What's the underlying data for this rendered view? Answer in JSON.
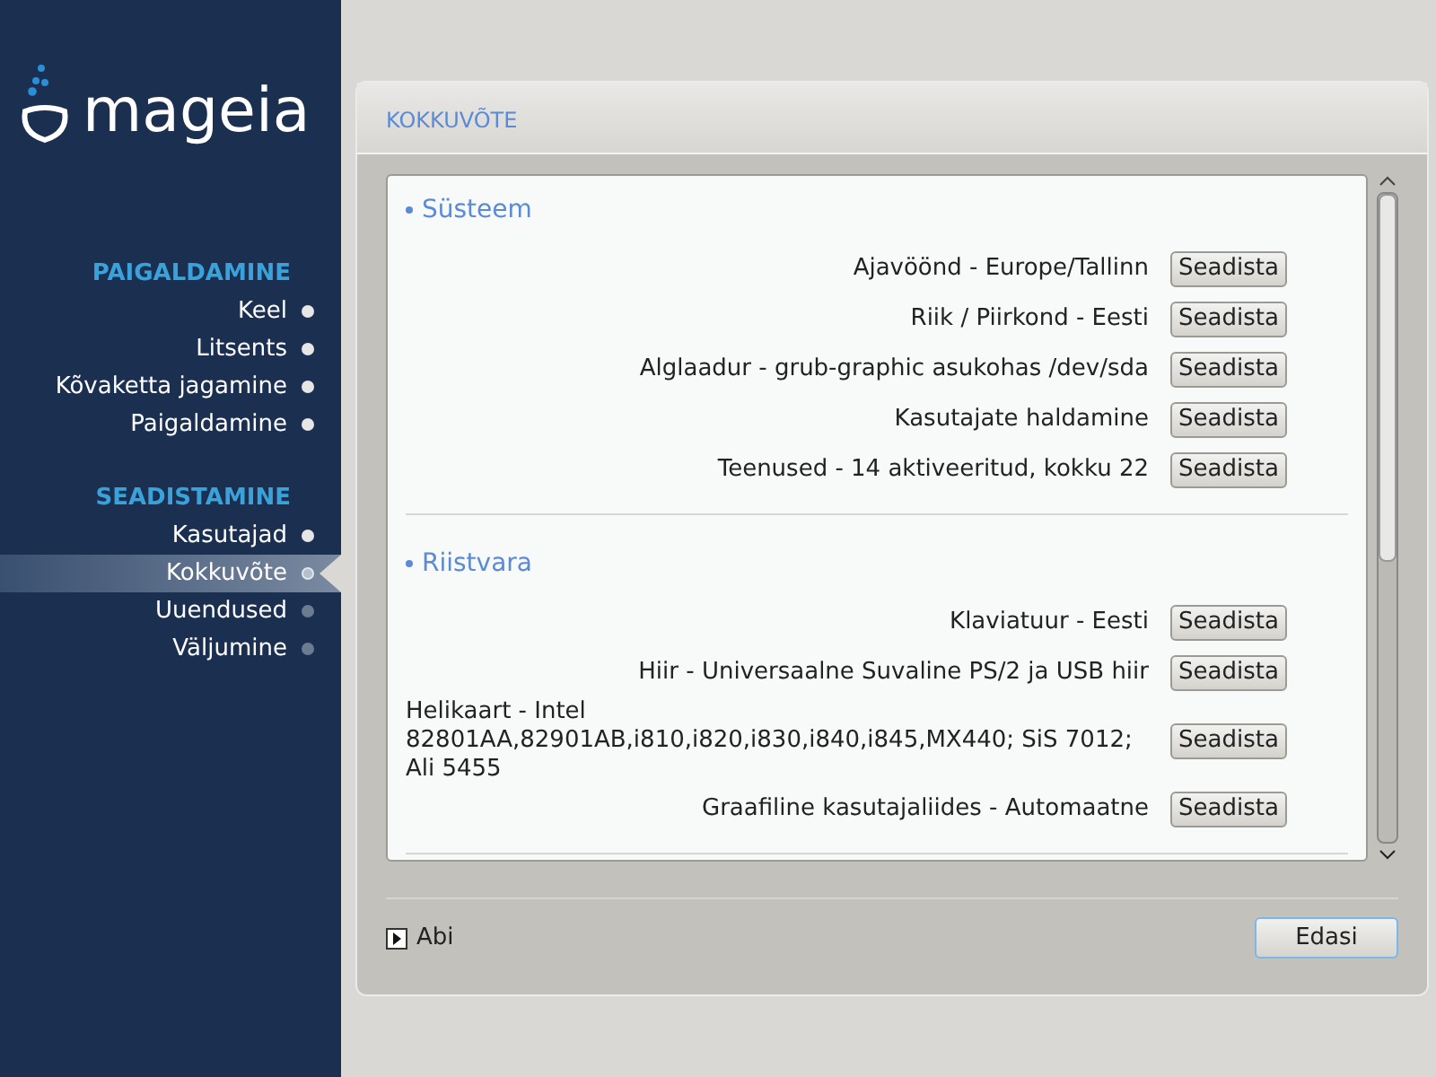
{
  "logo": {
    "text": "mageia"
  },
  "sidebar": {
    "groups": [
      {
        "title": "PAIGALDAMINE",
        "items": [
          {
            "label": "Keel",
            "done": true,
            "selected": false
          },
          {
            "label": "Litsents",
            "done": true,
            "selected": false
          },
          {
            "label": "Kõvaketta jagamine",
            "done": true,
            "selected": false
          },
          {
            "label": "Paigaldamine",
            "done": true,
            "selected": false
          }
        ]
      },
      {
        "title": "SEADISTAMINE",
        "items": [
          {
            "label": "Kasutajad",
            "done": true,
            "selected": false
          },
          {
            "label": "Kokkuvõte",
            "done": false,
            "selected": true
          },
          {
            "label": "Uuendused",
            "done": false,
            "selected": false
          },
          {
            "label": "Väljumine",
            "done": false,
            "selected": false
          }
        ]
      }
    ]
  },
  "panel": {
    "title": "KOKKUVÕTE",
    "sections": [
      {
        "title": "Süsteem",
        "rows": [
          {
            "label": "Ajavöönd - Europe/Tallinn",
            "button": "Seadista"
          },
          {
            "label": "Riik / Piirkond - Eesti",
            "button": "Seadista"
          },
          {
            "label": "Alglaadur - grub-graphic asukohas /dev/sda",
            "button": "Seadista"
          },
          {
            "label": "Kasutajate haldamine",
            "button": "Seadista"
          },
          {
            "label": "Teenused - 14 aktiveeritud, kokku 22",
            "button": "Seadista"
          }
        ]
      },
      {
        "title": "Riistvara",
        "rows": [
          {
            "label": "Klaviatuur - Eesti",
            "button": "Seadista"
          },
          {
            "label": "Hiir - Universaalne Suvaline PS/2 ja USB hiir",
            "button": "Seadista"
          },
          {
            "label": "Helikaart - Intel 82801AA,82901AB,i810,i820,i830,i840,i845,MX440; SiS 7012; Ali 5455",
            "button": "Seadista"
          },
          {
            "label": "Graafiline kasutajaliides - Automaatne",
            "button": "Seadista"
          }
        ]
      }
    ],
    "help": "Abi",
    "next": "Edasi"
  }
}
